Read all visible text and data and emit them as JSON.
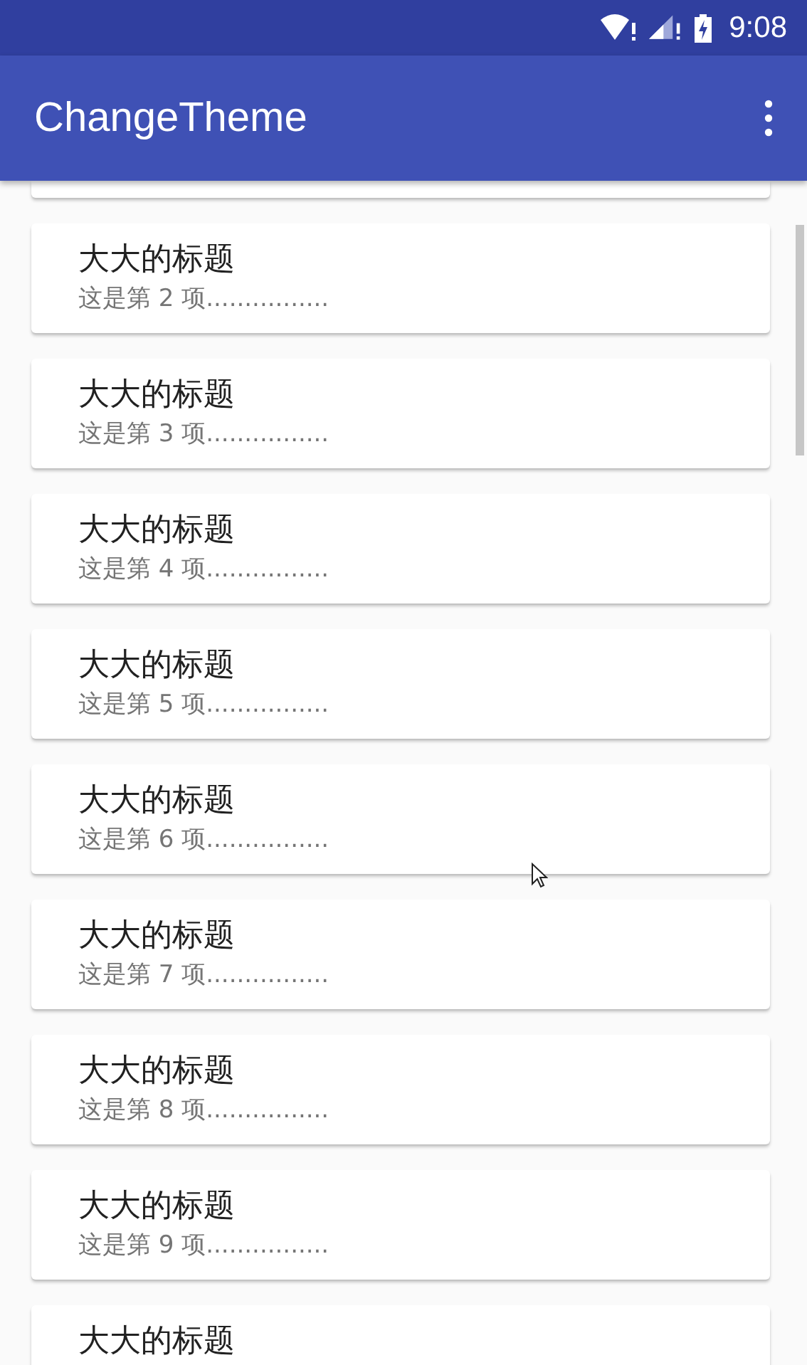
{
  "status_bar": {
    "time": "9:08"
  },
  "app_bar": {
    "title": "ChangeTheme"
  },
  "list": {
    "items": [
      {
        "title": "大大的标题",
        "subtitle": "这是第 2 项................"
      },
      {
        "title": "大大的标题",
        "subtitle": "这是第 3 项................"
      },
      {
        "title": "大大的标题",
        "subtitle": "这是第 4 项................"
      },
      {
        "title": "大大的标题",
        "subtitle": "这是第 5 项................"
      },
      {
        "title": "大大的标题",
        "subtitle": "这是第 6 项................"
      },
      {
        "title": "大大的标题",
        "subtitle": "这是第 7 项................"
      },
      {
        "title": "大大的标题",
        "subtitle": "这是第 8 项................"
      },
      {
        "title": "大大的标题",
        "subtitle": "这是第 9 项................"
      },
      {
        "title": "大大的标题"
      }
    ]
  }
}
